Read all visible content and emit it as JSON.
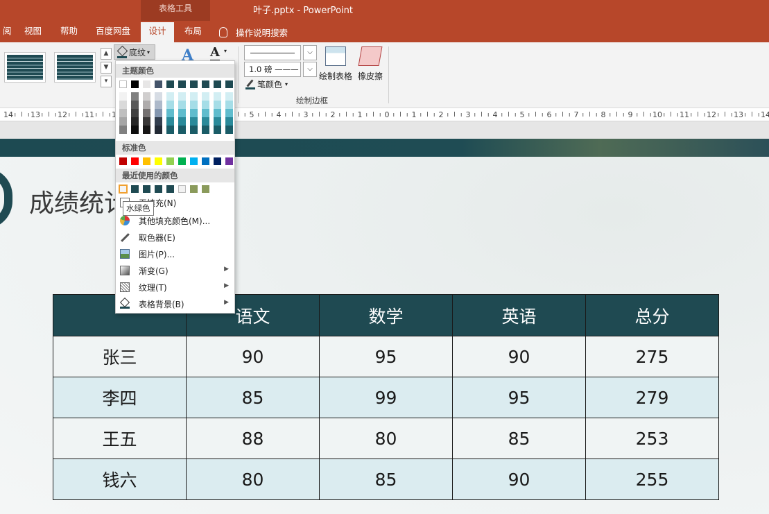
{
  "window": {
    "context_tab": "表格工具",
    "title": "叶子.pptx  -  PowerPoint"
  },
  "tabs": [
    "阅",
    "视图",
    "帮助",
    "百度网盘",
    "设计",
    "布局"
  ],
  "tell_me": "操作说明搜索",
  "ribbon": {
    "shading_label": "底纹",
    "pen_weight": "1.0 磅",
    "pen_color": "笔颜色",
    "draw_table": "绘制表格",
    "eraser": "橡皮擦",
    "group_label": "绘制边框"
  },
  "ruler_ticks": [
    "14",
    "13",
    "12",
    "11",
    "10",
    "9",
    "8",
    "7",
    "6",
    "5",
    "4",
    "3",
    "2",
    "1",
    "0",
    "1",
    "2",
    "3",
    "4",
    "5",
    "6",
    "7",
    "8",
    "9",
    "10",
    "11",
    "12",
    "13",
    "14"
  ],
  "dropdown": {
    "theme_colors_label": "主题颜色",
    "standard_colors_label": "标准色",
    "recent_colors_label": "最近使用的颜色",
    "theme_top": [
      "#ffffff",
      "#000000",
      "#e7e6e6",
      "#44546a",
      "#1f4a52",
      "#1f4a52",
      "#1f4a52",
      "#1f4a52",
      "#1f4a52",
      "#1f4a52"
    ],
    "theme_shades": [
      [
        "#f2f2f2",
        "#d9d9d9",
        "#bfbfbf",
        "#a6a6a6",
        "#808080"
      ],
      [
        "#808080",
        "#595959",
        "#404040",
        "#262626",
        "#0d0d0d"
      ],
      [
        "#d0cece",
        "#aeabab",
        "#757171",
        "#3a3838",
        "#171616"
      ],
      [
        "#d6dce4",
        "#adb9ca",
        "#8497b0",
        "#333f4f",
        "#222a35"
      ],
      [
        "#d2eef3",
        "#a5dde7",
        "#5fbccd",
        "#2a8a9a",
        "#1a5c67"
      ],
      [
        "#d2eef3",
        "#a5dde7",
        "#5fbccd",
        "#2a8a9a",
        "#1a5c67"
      ],
      [
        "#d2eef3",
        "#a5dde7",
        "#5fbccd",
        "#2a8a9a",
        "#1a5c67"
      ],
      [
        "#d2eef3",
        "#a5dde7",
        "#5fbccd",
        "#2a8a9a",
        "#1a5c67"
      ],
      [
        "#d2eef3",
        "#a5dde7",
        "#5fbccd",
        "#2a8a9a",
        "#1a5c67"
      ],
      [
        "#d2eef3",
        "#a5dde7",
        "#5fbccd",
        "#2a8a9a",
        "#1a5c67"
      ]
    ],
    "standard_colors": [
      "#c00000",
      "#ff0000",
      "#ffc000",
      "#ffff00",
      "#92d050",
      "#00b050",
      "#00b0f0",
      "#0070c0",
      "#002060",
      "#7030a0"
    ],
    "recent_colors": [
      "#f4f4f4",
      "#1f4a52",
      "#1f4a52",
      "#1f4a52",
      "#1f4a52",
      "#f2f2f2",
      "#8a9a5b",
      "#8a9a5b"
    ],
    "tooltip": "水绿色",
    "no_fill": "无填充(N)",
    "menu": [
      {
        "label": "其他填充颜色(M)...",
        "icon": "palette-icon",
        "submenu": false
      },
      {
        "label": "取色器(E)",
        "icon": "eyedropper-icon",
        "submenu": false
      },
      {
        "label": "图片(P)...",
        "icon": "picture-icon",
        "submenu": false
      },
      {
        "label": "渐变(G)",
        "icon": "gradient-icon",
        "submenu": true
      },
      {
        "label": "纹理(T)",
        "icon": "texture-icon",
        "submenu": true
      },
      {
        "label": "表格背景(B)",
        "icon": "table-background-icon",
        "submenu": true
      }
    ]
  },
  "slide": {
    "title": "成绩统计",
    "table": {
      "headers": [
        "",
        "语文",
        "数学",
        "英语",
        "总分"
      ],
      "rows": [
        [
          "张三",
          "90",
          "95",
          "90",
          "275"
        ],
        [
          "李四",
          "85",
          "99",
          "95",
          "279"
        ],
        [
          "王五",
          "88",
          "80",
          "85",
          "253"
        ],
        [
          "钱六",
          "80",
          "85",
          "90",
          "255"
        ]
      ]
    }
  },
  "colors": {
    "accent": "#b7472a",
    "table_header": "#1f4a52",
    "row_alt": "#dbecf0"
  }
}
